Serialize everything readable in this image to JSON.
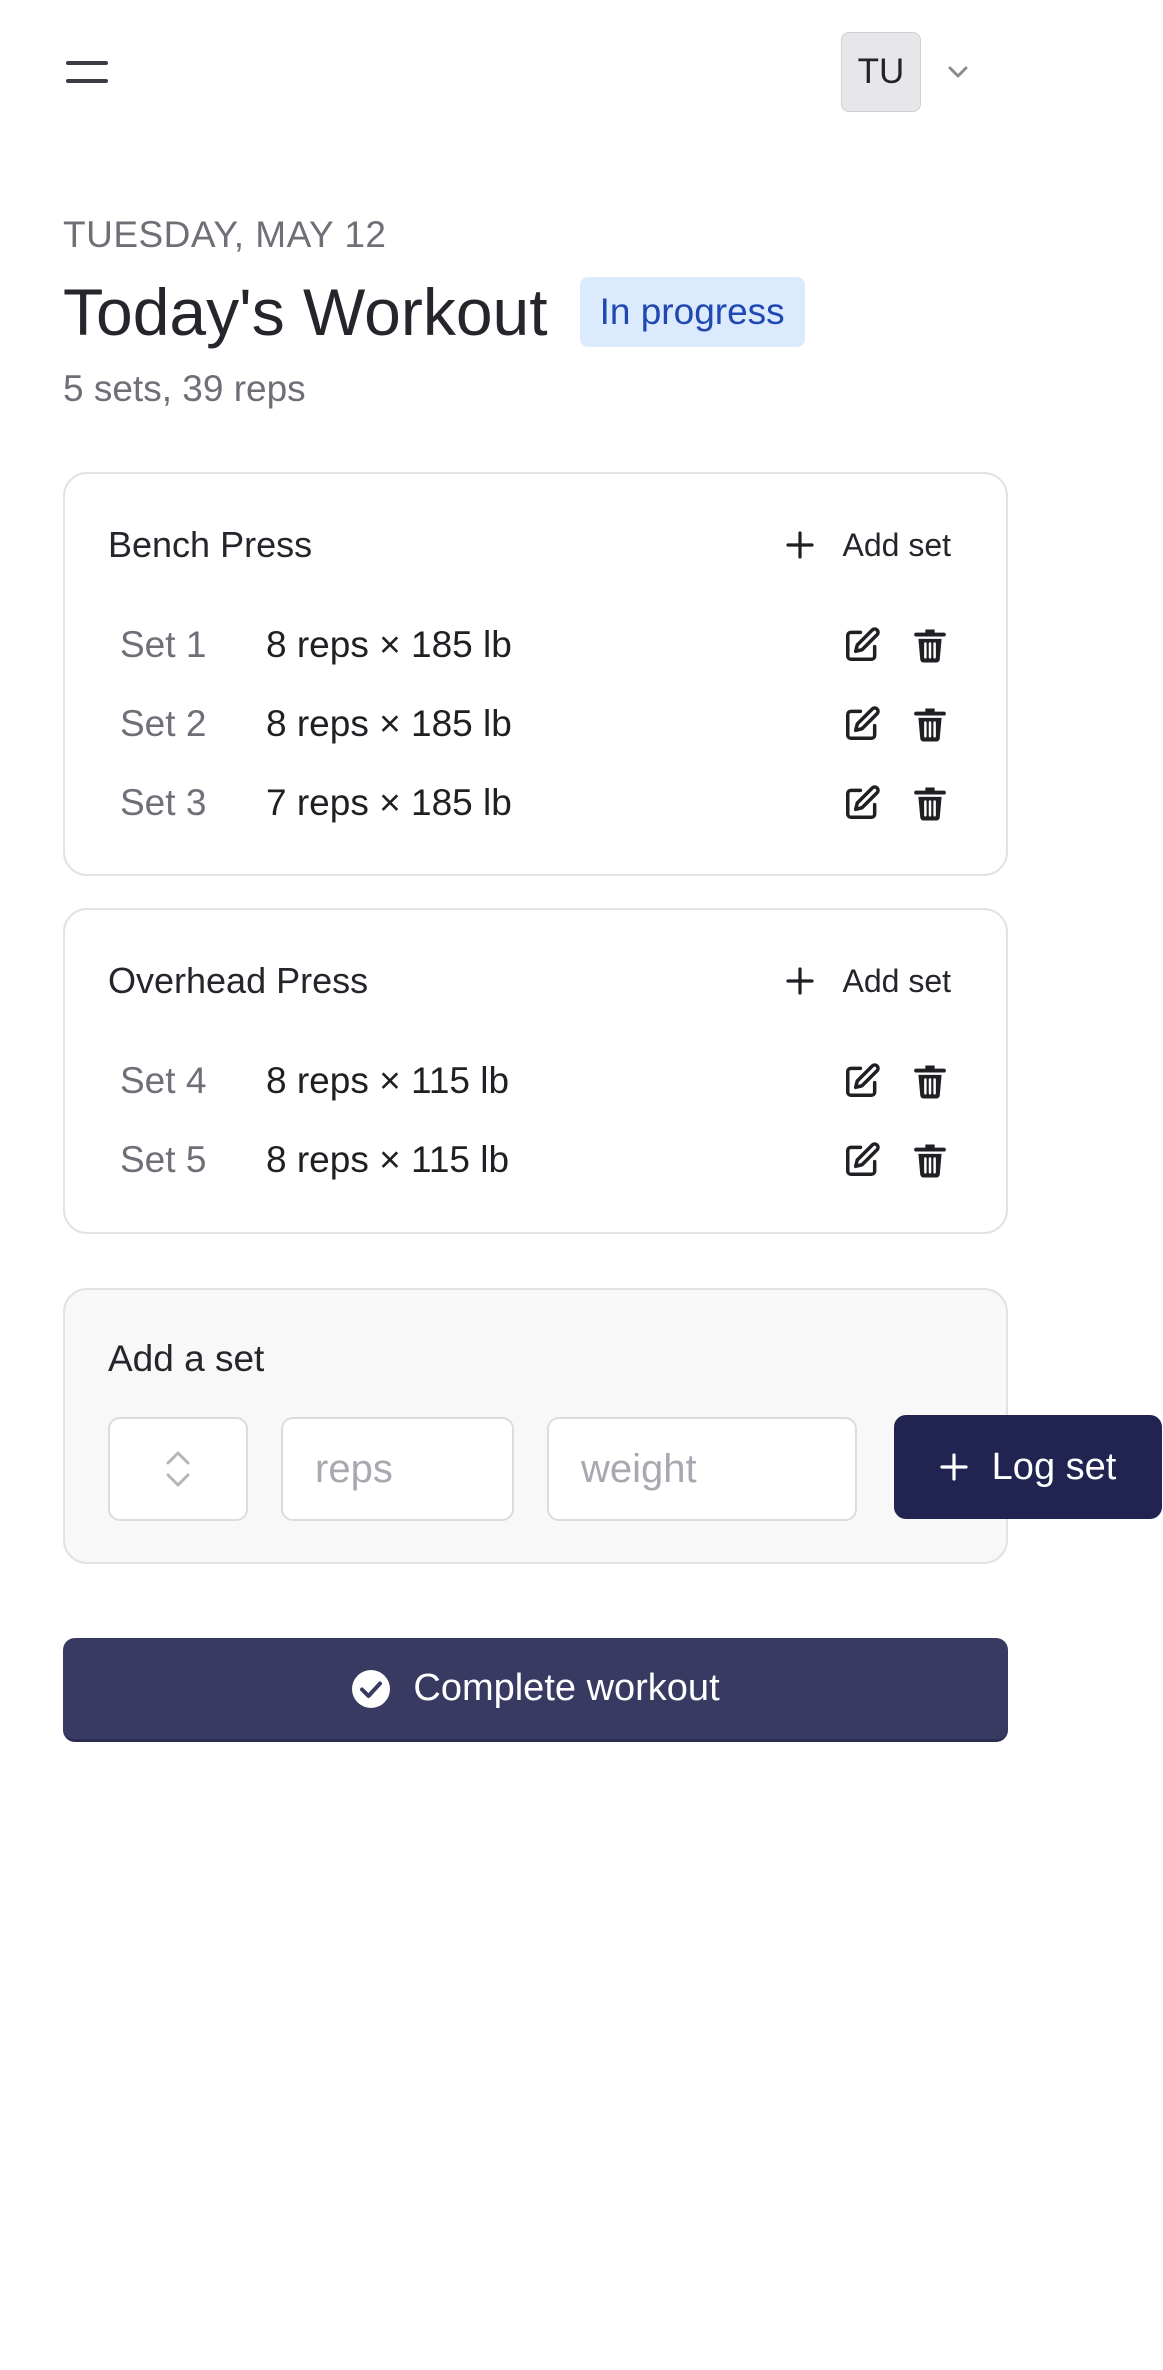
{
  "header": {
    "user_initials": "TU"
  },
  "workout": {
    "date": "TUESDAY, MAY 12",
    "title": "Today's Workout",
    "status": "In progress",
    "summary": "5 sets, 39 reps"
  },
  "exercises": [
    {
      "name": "Bench Press",
      "add_set_label": "Add set",
      "sets": [
        {
          "label": "Set 1",
          "detail": "8 reps × 185 lb"
        },
        {
          "label": "Set 2",
          "detail": "8 reps × 185 lb"
        },
        {
          "label": "Set 3",
          "detail": "7 reps × 185 lb"
        }
      ]
    },
    {
      "name": "Overhead Press",
      "add_set_label": "Add set",
      "sets": [
        {
          "label": "Set 4",
          "detail": "8 reps × 115 lb"
        },
        {
          "label": "Set 5",
          "detail": "8 reps × 115 lb"
        }
      ]
    }
  ],
  "add_set_form": {
    "title": "Add a set",
    "reps_placeholder": "reps",
    "weight_placeholder": "weight",
    "log_button": "Log set"
  },
  "complete_button": "Complete workout",
  "colors": {
    "primary_dark": "#212451",
    "complete_button": "#383a62",
    "status_bg": "#dceafe",
    "status_text": "#1f48b0"
  },
  "icons": {
    "menu": "hamburger-icon",
    "user_menu": "chevron-down-icon",
    "add": "plus-icon",
    "edit": "edit-icon",
    "delete": "trash-icon",
    "stepper": "up-down-stepper-icon",
    "complete": "check-circle-icon"
  }
}
